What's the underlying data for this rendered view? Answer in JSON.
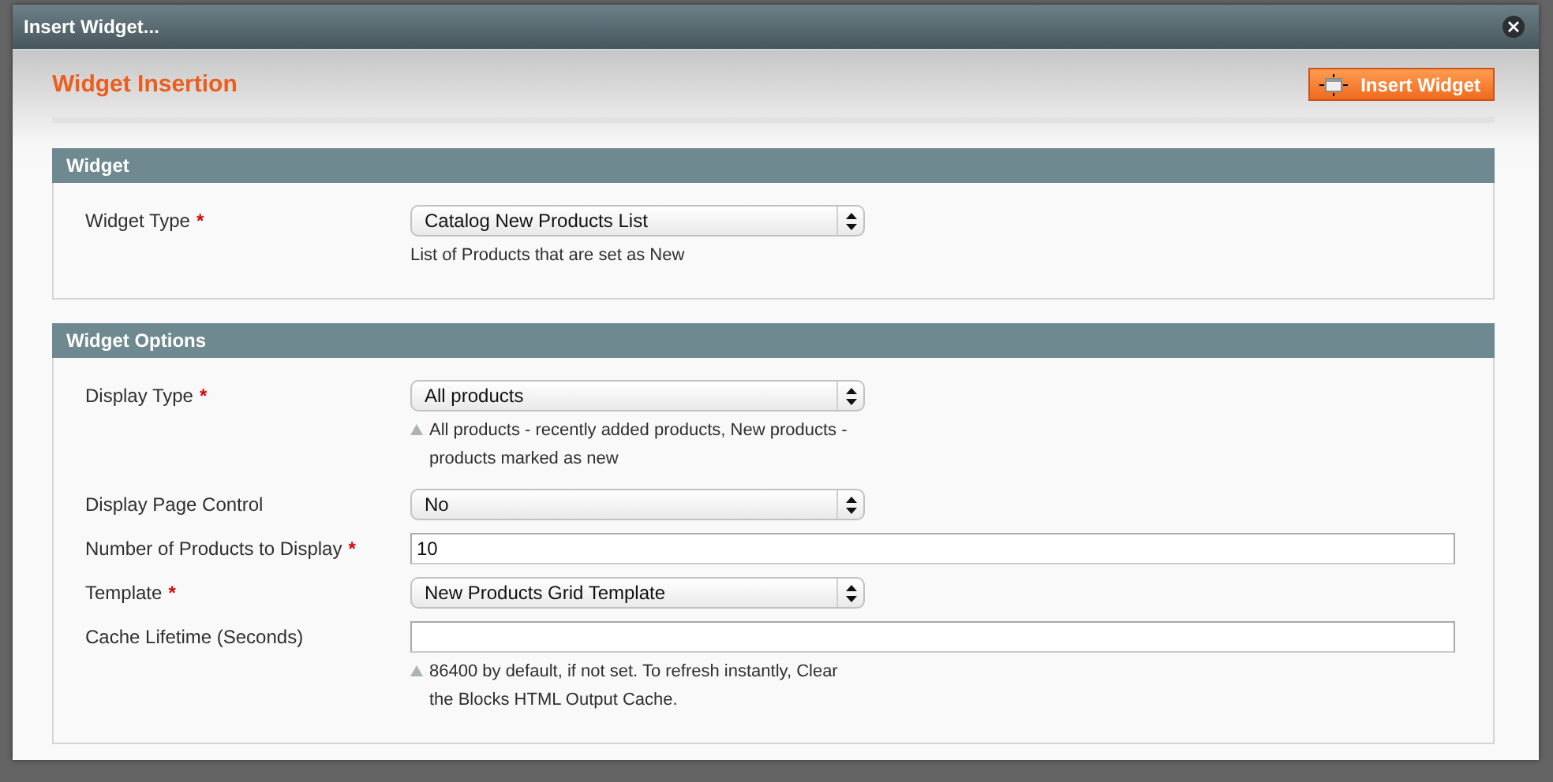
{
  "dialog": {
    "title": "Insert Widget...",
    "heading": "Widget Insertion",
    "action_button": "Insert Widget"
  },
  "sections": [
    {
      "title": "Widget",
      "fields": [
        {
          "kind": "select",
          "label": "Widget Type",
          "required_mark": "*",
          "value": "Catalog New Products List",
          "note": "List of Products that are set as New",
          "note_icon": false
        }
      ]
    },
    {
      "title": "Widget Options",
      "fields": [
        {
          "kind": "select",
          "label": "Display Type",
          "required_mark": "*",
          "value": "All products",
          "note": "All products - recently added products, New products - products marked as new",
          "note_icon": true
        },
        {
          "kind": "select",
          "label": "Display Page Control",
          "value": "No"
        },
        {
          "kind": "text",
          "label": "Number of Products to Display",
          "required_mark": "*",
          "value": "10"
        },
        {
          "kind": "select",
          "label": "Template",
          "required_mark": "*",
          "value": "New Products Grid Template"
        },
        {
          "kind": "text",
          "label": "Cache Lifetime (Seconds)",
          "note": "86400 by default, if not set. To refresh instantly, Clear the Blocks HTML Output Cache.",
          "note_icon": true
        }
      ]
    }
  ]
}
